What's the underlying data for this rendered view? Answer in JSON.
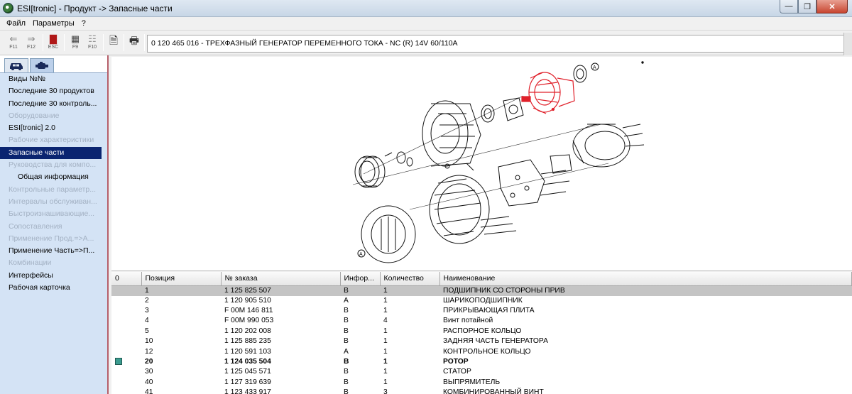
{
  "window": {
    "title": "ESI[tronic] - Продукт -> Запасные части"
  },
  "window_controls": {
    "minimize": "—",
    "maximize": "❐",
    "close": "✕"
  },
  "menu": [
    "Файл",
    "Параметры",
    "?"
  ],
  "toolbar": {
    "buttons": [
      {
        "name": "back",
        "icon": "arrow-left-icon",
        "glyph": "⇐",
        "key": "F11"
      },
      {
        "name": "forward",
        "icon": "arrow-right-icon",
        "glyph": "⇒",
        "key": "F12"
      },
      {
        "name": "esc",
        "icon": "book-icon",
        "glyph": "▇",
        "key": "ESC"
      },
      {
        "name": "f9",
        "icon": "grid-icon",
        "glyph": "▦",
        "key": "F9"
      },
      {
        "name": "f10",
        "icon": "tree-icon",
        "glyph": "☷",
        "key": "F10"
      },
      {
        "name": "document",
        "icon": "document-icon",
        "glyph": "🗎",
        "key": ""
      },
      {
        "name": "print",
        "icon": "printer-icon",
        "glyph": "🖶",
        "key": ""
      }
    ],
    "product": "0 120 465 016 - ТРЕХФАЗНЫЙ ГЕНЕРАТОР ПЕРЕМЕННОГО ТОКА - NC (R) 14V 60/110A"
  },
  "vehicle_tabs": [
    {
      "icon": "car-icon",
      "active": false
    },
    {
      "icon": "engine-icon",
      "active": true
    }
  ],
  "nav": [
    {
      "label": "Виды №№",
      "state": "normal"
    },
    {
      "label": "Последние 30 продуктов",
      "state": "normal"
    },
    {
      "label": "Последние 30 контроль...",
      "state": "normal"
    },
    {
      "label": "Оборудование",
      "state": "disabled"
    },
    {
      "label": "ESI[tronic] 2.0",
      "state": "normal"
    },
    {
      "label": "Рабочие характеристики",
      "state": "disabled"
    },
    {
      "label": "Запасные части",
      "state": "selected"
    },
    {
      "label": "Руководства для компо...",
      "state": "disabled"
    },
    {
      "label": "Общая информация",
      "state": "indent"
    },
    {
      "label": "Контрольные параметр...",
      "state": "disabled"
    },
    {
      "label": "Интервалы обслуживан...",
      "state": "disabled"
    },
    {
      "label": "Быстроизнашивающие...",
      "state": "disabled"
    },
    {
      "label": "Сопоставления",
      "state": "disabled"
    },
    {
      "label": "Применение Прод.=>А...",
      "state": "disabled"
    },
    {
      "label": "Применение Часть=>П...",
      "state": "normal"
    },
    {
      "label": "Комбинации",
      "state": "disabled"
    },
    {
      "label": "Интерфейсы",
      "state": "normal"
    },
    {
      "label": "Рабочая карточка",
      "state": "normal"
    }
  ],
  "drawing": {
    "callout_a": "A",
    "callout_b": "A",
    "highlight_color": "#e0202a"
  },
  "table": {
    "columns": [
      "0",
      "Позиция",
      "№ заказа",
      "Инфор...",
      "Количество",
      "Наименование"
    ],
    "rows": [
      {
        "flag": false,
        "pos": "1",
        "order": "1 125 825 507",
        "info": "B",
        "qty": "1",
        "name": "ПОДШИПНИК СО СТОРОНЫ ПРИВ",
        "selected": true,
        "bold": false
      },
      {
        "flag": false,
        "pos": "2",
        "order": "1 120 905 510",
        "info": "A",
        "qty": "1",
        "name": "ШАРИКОПОДШИПНИК",
        "selected": false,
        "bold": false
      },
      {
        "flag": false,
        "pos": "3",
        "order": "F 00M 146 811",
        "info": "B",
        "qty": "1",
        "name": "ПРИКРЫВАЮЩАЯ ПЛИТА",
        "selected": false,
        "bold": false
      },
      {
        "flag": false,
        "pos": "4",
        "order": "F 00M 990 053",
        "info": "B",
        "qty": "4",
        "name": "Винт потайной",
        "selected": false,
        "bold": false
      },
      {
        "flag": false,
        "pos": "5",
        "order": "1 120 202 008",
        "info": "B",
        "qty": "1",
        "name": "РАСПОРНОЕ КОЛЬЦО",
        "selected": false,
        "bold": false
      },
      {
        "flag": false,
        "pos": "10",
        "order": "1 125 885 235",
        "info": "B",
        "qty": "1",
        "name": "ЗАДНЯЯ ЧАСТЬ ГЕНЕРАТОРА",
        "selected": false,
        "bold": false
      },
      {
        "flag": false,
        "pos": "12",
        "order": "1 120 591 103",
        "info": "A",
        "qty": "1",
        "name": "КОНТРОЛЬНОЕ КОЛЬЦО",
        "selected": false,
        "bold": false
      },
      {
        "flag": true,
        "pos": "20",
        "order": "1 124 035 504",
        "info": "B",
        "qty": "1",
        "name": "РОТОР",
        "selected": false,
        "bold": true
      },
      {
        "flag": false,
        "pos": "30",
        "order": "1 125 045 571",
        "info": "B",
        "qty": "1",
        "name": "СТАТОР",
        "selected": false,
        "bold": false
      },
      {
        "flag": false,
        "pos": "40",
        "order": "1 127 319 639",
        "info": "B",
        "qty": "1",
        "name": "ВЫПРЯМИТЕЛЬ",
        "selected": false,
        "bold": false
      },
      {
        "flag": false,
        "pos": "41",
        "order": "1 123 433 917",
        "info": "B",
        "qty": "3",
        "name": "КОМБИНИРОВАННЫЙ ВИНТ",
        "selected": false,
        "bold": false
      }
    ]
  }
}
